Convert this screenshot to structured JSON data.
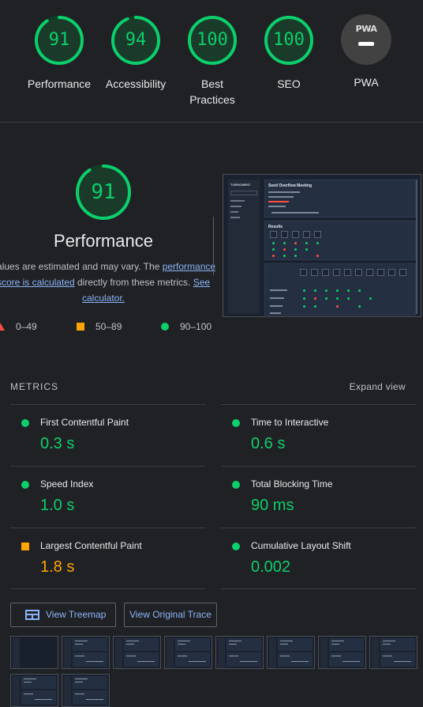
{
  "scores": [
    {
      "value": "91",
      "label": "Performance",
      "fraction": 0.91,
      "color": "#0cce6b"
    },
    {
      "value": "94",
      "label": "Accessibility",
      "fraction": 0.94,
      "color": "#0cce6b"
    },
    {
      "value": "100",
      "label": "Best Practices",
      "fraction": 1.0,
      "color": "#0cce6b"
    },
    {
      "value": "100",
      "label": "SEO",
      "fraction": 1.0,
      "color": "#0cce6b"
    }
  ],
  "pwa": {
    "logo": "PWA",
    "label": "PWA"
  },
  "performance": {
    "score": "91",
    "fraction": 0.91,
    "title": "Performance",
    "desc_1": "Values are estimated and may vary. The ",
    "desc_link": "performance score is calculated",
    "desc_2": " directly from these metrics. ",
    "calc_link": "See calculator."
  },
  "legend": [
    {
      "icon": "triangle-fail-icon",
      "range": "0–49",
      "color": "#ff4e42"
    },
    {
      "icon": "square-average-icon",
      "range": "50–89",
      "color": "#ffa400"
    },
    {
      "icon": "circle-pass-icon",
      "range": "90–100",
      "color": "#0cce6b"
    }
  ],
  "thumbnail": {
    "sidebar_title": "TURNOMENT",
    "panel1_title": "Seed Overflow Meeting",
    "panel2_title": "Results"
  },
  "metrics": {
    "heading": "METRICS",
    "expand_label": "Expand view",
    "items": [
      {
        "name": "First Contentful Paint",
        "value": "0.3 s",
        "status": "pass"
      },
      {
        "name": "Time to Interactive",
        "value": "0.6 s",
        "status": "pass"
      },
      {
        "name": "Speed Index",
        "value": "1.0 s",
        "status": "pass"
      },
      {
        "name": "Total Blocking Time",
        "value": "90 ms",
        "status": "pass"
      },
      {
        "name": "Largest Contentful Paint",
        "value": "1.8 s",
        "status": "average"
      },
      {
        "name": "Cumulative Layout Shift",
        "value": "0.002",
        "status": "pass"
      }
    ]
  },
  "buttons": {
    "treemap": "View Treemap",
    "trace": "View Original Trace"
  },
  "filmstrip_count": 10
}
